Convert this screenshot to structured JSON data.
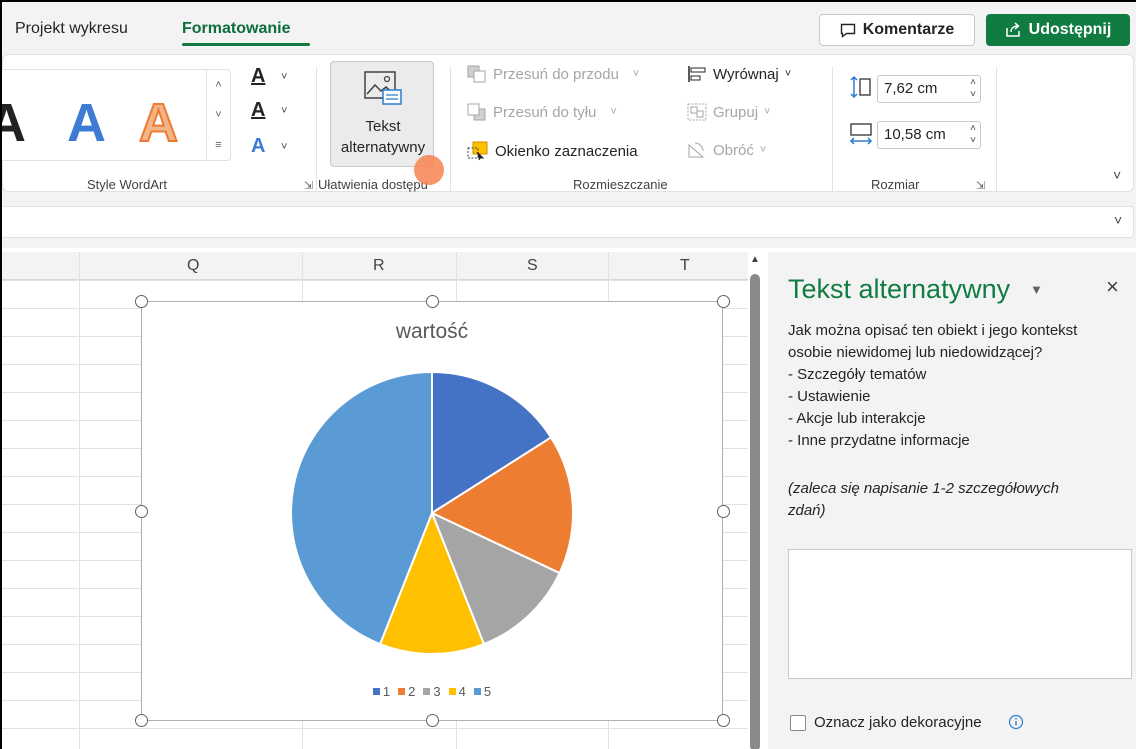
{
  "tabs": {
    "projekt": "Projekt wykresu",
    "formatowanie": "Formatowanie"
  },
  "header": {
    "komentarze": "Komentarze",
    "udostepnij": "Udostępnij"
  },
  "ribbon": {
    "groups": {
      "wordart": "Style WordArt",
      "ulatwienia": "Ułatwienia dostępu",
      "rozmieszczanie": "Rozmieszczanie",
      "rozmiar": "Rozmiar"
    },
    "wordart_sample": "A",
    "alt_text": {
      "line1": "Tekst",
      "line2": "alternatywny"
    },
    "arrange": {
      "przesun_przod": "Przesuń do przodu",
      "przesun_tyl": "Przesuń do tyłu",
      "okienko": "Okienko zaznaczenia",
      "wyrownaj": "Wyrównaj",
      "grupuj": "Grupuj",
      "obroc": "Obróć"
    },
    "size": {
      "height": "7,62 cm",
      "width": "10,58 cm"
    }
  },
  "columns": [
    "Q",
    "R",
    "S",
    "T"
  ],
  "chart_data": {
    "type": "pie",
    "title": "wartość",
    "categories": [
      "1",
      "2",
      "3",
      "4",
      "5"
    ],
    "values": [
      16,
      16,
      12,
      12,
      44
    ],
    "colors": [
      "#4472c4",
      "#ed7d31",
      "#a5a5a5",
      "#ffc000",
      "#5b9bd5"
    ],
    "legend_position": "bottom"
  },
  "pane": {
    "title": "Tekst alternatywny",
    "question_line1": "Jak można opisać ten obiekt i jego kontekst",
    "question_line2": "osobie niewidomej lub niedowidzącej?",
    "bullets": [
      "- Szczegóły tematów",
      "- Ustawienie",
      "- Akcje lub interakcje",
      "- Inne przydatne informacje"
    ],
    "hint_line1": "(zaleca się napisanie 1-2 szczegółowych",
    "hint_line2": "zdań)",
    "decorative_label": "Oznacz jako dekoracyjne"
  },
  "colors": {
    "accent": "#107c41"
  }
}
